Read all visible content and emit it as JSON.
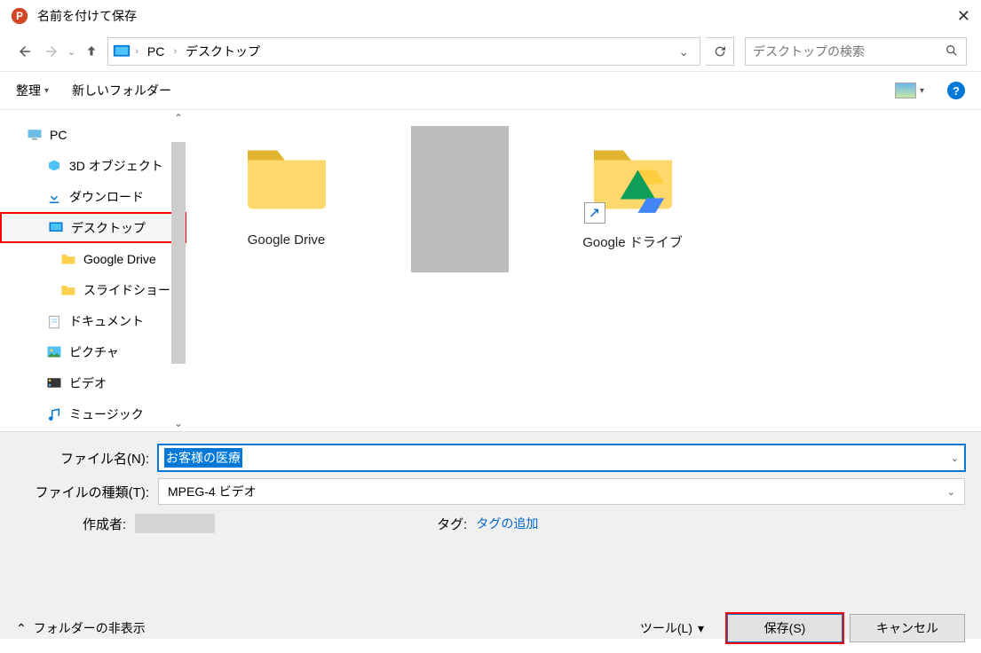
{
  "titlebar": {
    "title": "名前を付けて保存"
  },
  "path": {
    "seg1": "PC",
    "seg2": "デスクトップ"
  },
  "search": {
    "placeholder": "デスクトップの検索"
  },
  "toolbar": {
    "organize": "整理",
    "newfolder": "新しいフォルダー"
  },
  "tree": {
    "pc": "PC",
    "objects3d": "3D オブジェクト",
    "downloads": "ダウンロード",
    "desktop": "デスクトップ",
    "gdrive": "Google Drive",
    "slideshow": "スライドショー",
    "documents": "ドキュメント",
    "pictures": "ピクチャ",
    "videos": "ビデオ",
    "music": "ミュージック"
  },
  "tiles": {
    "gdrive": "Google Drive",
    "gdrive_jp": "Google ドライブ"
  },
  "form": {
    "filename_label": "ファイル名(N):",
    "filename_value": "お客様の医療",
    "filetype_label": "ファイルの種類(T):",
    "filetype_value": "MPEG-4 ビデオ",
    "author_label": "作成者:",
    "tag_label": "タグ:",
    "tag_value": "タグの追加"
  },
  "actions": {
    "hide_folders": "フォルダーの非表示",
    "tools": "ツール(L)",
    "save": "保存(S)",
    "cancel": "キャンセル"
  }
}
